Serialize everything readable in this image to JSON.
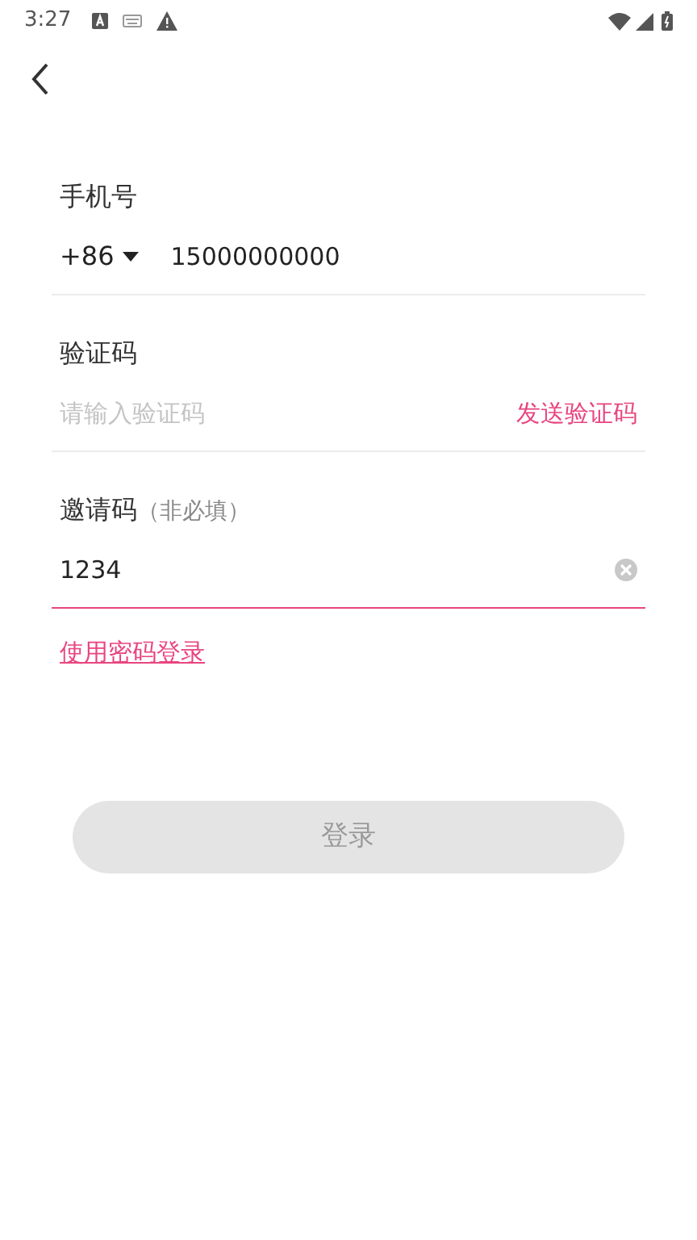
{
  "status_bar": {
    "time": "3:27"
  },
  "phone": {
    "label": "手机号",
    "country_code": "+86",
    "value": "15000000000",
    "focused": false
  },
  "code": {
    "label": "验证码",
    "placeholder": "请输入验证码",
    "send_link": "发送验证码",
    "focused": false
  },
  "invite": {
    "label": "邀请码",
    "hint": "（非必填）",
    "value": "1234",
    "focused": true
  },
  "password_login_link": "使用密码登录",
  "login_button": {
    "label": "登录",
    "disabled": true
  }
}
